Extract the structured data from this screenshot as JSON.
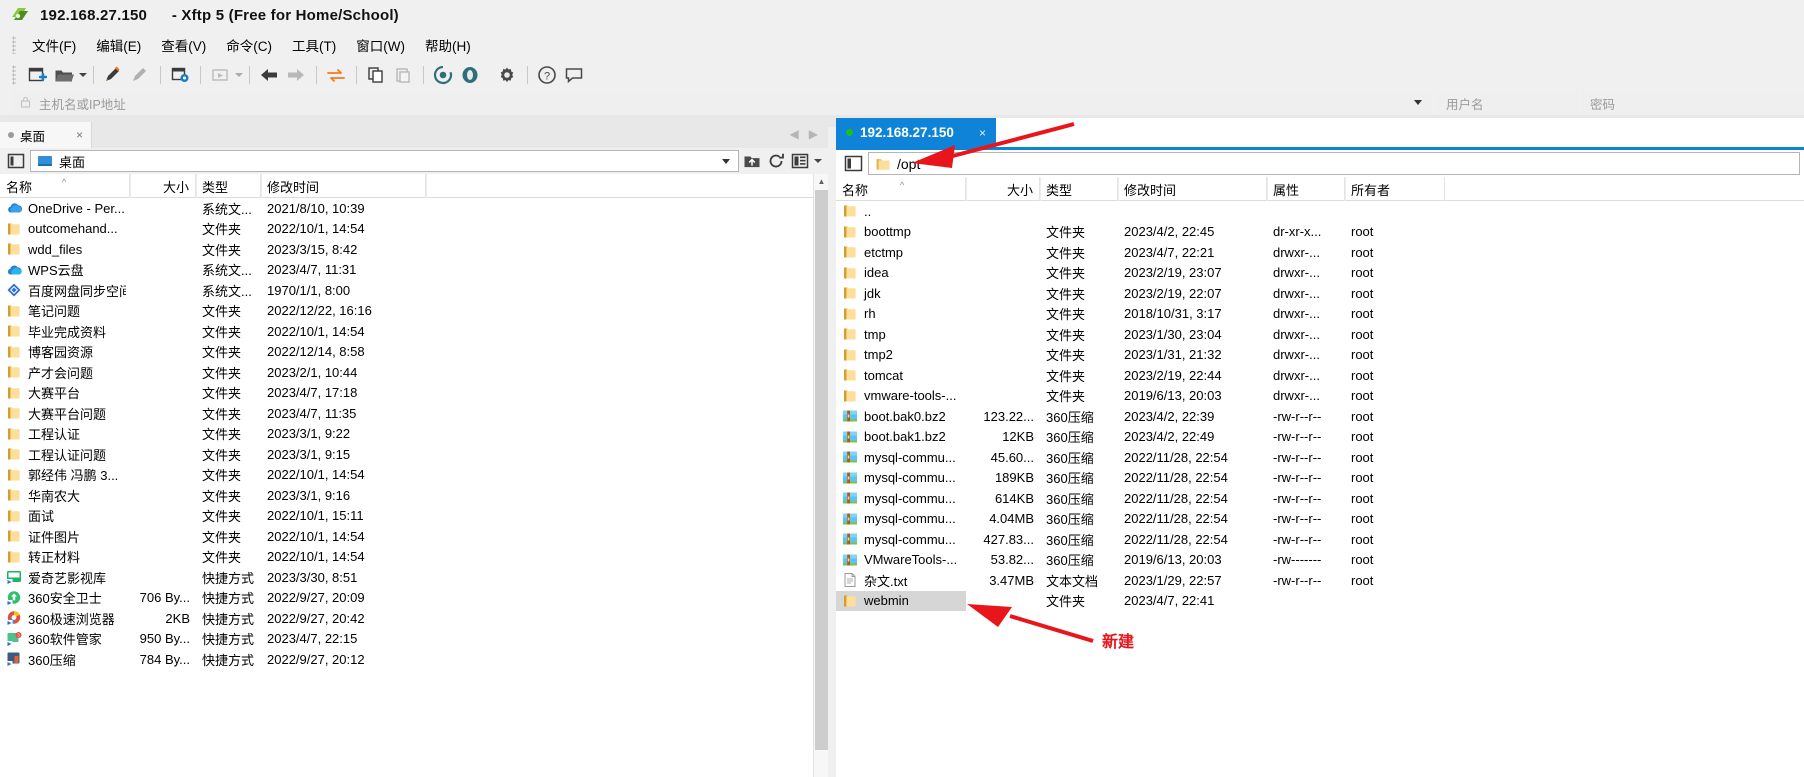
{
  "window": {
    "title_ip": "192.168.27.150",
    "title_app": "- Xftp 5 (Free for Home/School)",
    "app_icon": "xftp-logo-icon"
  },
  "menubar": {
    "items": [
      {
        "label": "文件(F)",
        "name": "menu-file"
      },
      {
        "label": "编辑(E)",
        "name": "menu-edit"
      },
      {
        "label": "查看(V)",
        "name": "menu-view"
      },
      {
        "label": "命令(C)",
        "name": "menu-command"
      },
      {
        "label": "工具(T)",
        "name": "menu-tools"
      },
      {
        "label": "窗口(W)",
        "name": "menu-window"
      },
      {
        "label": "帮助(H)",
        "name": "menu-help"
      }
    ]
  },
  "toolbar": {
    "buttons": [
      "new-session-icon",
      "open-folder-icon",
      "dropdown-caret-icon",
      "edit-session-icon",
      "disconnect-icon",
      "session-properties-icon",
      "run-icon",
      "run-caret-icon",
      "back-icon",
      "forward-icon",
      "transfer-icon",
      "copy-icon",
      "paste-icon",
      "sync-browse-icon",
      "transfer-queue-icon",
      "settings-gear-icon",
      "help-icon",
      "feedback-icon"
    ]
  },
  "connectbar": {
    "host_placeholder": "主机名或IP地址",
    "user_placeholder": "用户名",
    "password_placeholder": "密码",
    "lock_icon": "lock-icon",
    "dropdown_icon": "chevron-down-icon"
  },
  "local_panel": {
    "tab_label": "桌面",
    "tab_close_icon": "close-icon",
    "nav_back_icon": "chevron-left-icon",
    "nav_forward_icon": "chevron-right-icon",
    "panel_toggle_icon": "split-panel-icon",
    "path_value": "桌面",
    "path_icon": "desktop-icon",
    "path_dropdown_icon": "chevron-down-icon",
    "tools": [
      "up-folder-icon",
      "refresh-icon",
      "view-mode-icon",
      "view-mode-caret-icon"
    ],
    "columns": [
      "名称",
      "大小",
      "类型",
      "修改时间"
    ],
    "sort_indicator": "sort-asc-icon",
    "rows": [
      {
        "name": "OneDrive - Per...",
        "size": "",
        "type": "系统文...",
        "date": "2021/8/10, 10:39",
        "icon": "onedrive-icon"
      },
      {
        "name": "outcomehand...",
        "size": "",
        "type": "文件夹",
        "date": "2022/10/1, 14:54",
        "icon": "folder-icon"
      },
      {
        "name": "wdd_files",
        "size": "",
        "type": "文件夹",
        "date": "2023/3/15, 8:42",
        "icon": "folder-icon"
      },
      {
        "name": "WPS云盘",
        "size": "",
        "type": "系统文...",
        "date": "2023/4/7, 11:31",
        "icon": "wps-cloud-icon"
      },
      {
        "name": "百度网盘同步空间",
        "size": "",
        "type": "系统文...",
        "date": "1970/1/1, 8:00",
        "icon": "baidu-netdisk-icon"
      },
      {
        "name": "笔记问题",
        "size": "",
        "type": "文件夹",
        "date": "2022/12/22, 16:16",
        "icon": "folder-icon"
      },
      {
        "name": "毕业完成资料",
        "size": "",
        "type": "文件夹",
        "date": "2022/10/1, 14:54",
        "icon": "folder-icon"
      },
      {
        "name": "博客园资源",
        "size": "",
        "type": "文件夹",
        "date": "2022/12/14, 8:58",
        "icon": "folder-icon"
      },
      {
        "name": "产才会问题",
        "size": "",
        "type": "文件夹",
        "date": "2023/2/1, 10:44",
        "icon": "folder-icon"
      },
      {
        "name": "大赛平台",
        "size": "",
        "type": "文件夹",
        "date": "2023/4/7, 17:18",
        "icon": "folder-icon"
      },
      {
        "name": "大赛平台问题",
        "size": "",
        "type": "文件夹",
        "date": "2023/4/7, 11:35",
        "icon": "folder-icon"
      },
      {
        "name": "工程认证",
        "size": "",
        "type": "文件夹",
        "date": "2023/3/1, 9:22",
        "icon": "folder-icon"
      },
      {
        "name": "工程认证问题",
        "size": "",
        "type": "文件夹",
        "date": "2023/3/1, 9:15",
        "icon": "folder-icon"
      },
      {
        "name": "郭经伟  冯鹏  3...",
        "size": "",
        "type": "文件夹",
        "date": "2022/10/1, 14:54",
        "icon": "folder-icon"
      },
      {
        "name": "华南农大",
        "size": "",
        "type": "文件夹",
        "date": "2023/3/1, 9:16",
        "icon": "folder-icon"
      },
      {
        "name": "面试",
        "size": "",
        "type": "文件夹",
        "date": "2022/10/1, 15:11",
        "icon": "folder-icon"
      },
      {
        "name": "证件图片",
        "size": "",
        "type": "文件夹",
        "date": "2022/10/1, 14:54",
        "icon": "folder-icon"
      },
      {
        "name": "转正材料",
        "size": "",
        "type": "文件夹",
        "date": "2022/10/1, 14:54",
        "icon": "folder-icon"
      },
      {
        "name": "爱奇艺影视库",
        "size": "",
        "type": "快捷方式",
        "date": "2023/3/30, 8:51",
        "icon": "iqiyi-icon"
      },
      {
        "name": "360安全卫士",
        "size": "706 By...",
        "type": "快捷方式",
        "date": "2022/9/27, 20:09",
        "icon": "360-safe-icon"
      },
      {
        "name": "360极速浏览器",
        "size": "2KB",
        "type": "快捷方式",
        "date": "2022/9/27, 20:42",
        "icon": "360-browser-icon"
      },
      {
        "name": "360软件管家",
        "size": "950 By...",
        "type": "快捷方式",
        "date": "2023/4/7, 22:15",
        "icon": "360-soft-icon"
      },
      {
        "name": "360压缩",
        "size": "784 By...",
        "type": "快捷方式",
        "date": "2022/9/27, 20:12",
        "icon": "360-zip-icon"
      }
    ]
  },
  "remote_panel": {
    "tab_label": "192.168.27.150",
    "tab_status_icon": "connected-dot-icon",
    "tab_close_icon": "close-icon",
    "panel_toggle_icon": "split-panel-icon",
    "path_value": "/opt",
    "path_icon": "folder-icon",
    "columns": [
      "名称",
      "大小",
      "类型",
      "修改时间",
      "属性",
      "所有者"
    ],
    "sort_indicator": "sort-asc-icon",
    "rows": [
      {
        "name": "..",
        "size": "",
        "type": "",
        "date": "",
        "attr": "",
        "owner": "",
        "icon": "folder-icon"
      },
      {
        "name": "boottmp",
        "size": "",
        "type": "文件夹",
        "date": "2023/4/2, 22:45",
        "attr": "dr-xr-x...",
        "owner": "root",
        "icon": "folder-icon"
      },
      {
        "name": "etctmp",
        "size": "",
        "type": "文件夹",
        "date": "2023/4/7, 22:21",
        "attr": "drwxr-...",
        "owner": "root",
        "icon": "folder-icon"
      },
      {
        "name": "idea",
        "size": "",
        "type": "文件夹",
        "date": "2023/2/19, 23:07",
        "attr": "drwxr-...",
        "owner": "root",
        "icon": "folder-icon"
      },
      {
        "name": "jdk",
        "size": "",
        "type": "文件夹",
        "date": "2023/2/19, 22:07",
        "attr": "drwxr-...",
        "owner": "root",
        "icon": "folder-icon"
      },
      {
        "name": "rh",
        "size": "",
        "type": "文件夹",
        "date": "2018/10/31, 3:17",
        "attr": "drwxr-...",
        "owner": "root",
        "icon": "folder-icon"
      },
      {
        "name": "tmp",
        "size": "",
        "type": "文件夹",
        "date": "2023/1/30, 23:04",
        "attr": "drwxr-...",
        "owner": "root",
        "icon": "folder-icon"
      },
      {
        "name": "tmp2",
        "size": "",
        "type": "文件夹",
        "date": "2023/1/31, 21:32",
        "attr": "drwxr-...",
        "owner": "root",
        "icon": "folder-icon"
      },
      {
        "name": "tomcat",
        "size": "",
        "type": "文件夹",
        "date": "2023/2/19, 22:44",
        "attr": "drwxr-...",
        "owner": "root",
        "icon": "folder-icon"
      },
      {
        "name": "vmware-tools-...",
        "size": "",
        "type": "文件夹",
        "date": "2019/6/13, 20:03",
        "attr": "drwxr-...",
        "owner": "root",
        "icon": "folder-icon"
      },
      {
        "name": "boot.bak0.bz2",
        "size": "123.22...",
        "type": "360压缩",
        "date": "2023/4/2, 22:39",
        "attr": "-rw-r--r--",
        "owner": "root",
        "icon": "archive-icon"
      },
      {
        "name": "boot.bak1.bz2",
        "size": "12KB",
        "type": "360压缩",
        "date": "2023/4/2, 22:49",
        "attr": "-rw-r--r--",
        "owner": "root",
        "icon": "archive-icon"
      },
      {
        "name": "mysql-commu...",
        "size": "45.60...",
        "type": "360压缩",
        "date": "2022/11/28, 22:54",
        "attr": "-rw-r--r--",
        "owner": "root",
        "icon": "archive-icon"
      },
      {
        "name": "mysql-commu...",
        "size": "189KB",
        "type": "360压缩",
        "date": "2022/11/28, 22:54",
        "attr": "-rw-r--r--",
        "owner": "root",
        "icon": "archive-icon"
      },
      {
        "name": "mysql-commu...",
        "size": "614KB",
        "type": "360压缩",
        "date": "2022/11/28, 22:54",
        "attr": "-rw-r--r--",
        "owner": "root",
        "icon": "archive-icon"
      },
      {
        "name": "mysql-commu...",
        "size": "4.04MB",
        "type": "360压缩",
        "date": "2022/11/28, 22:54",
        "attr": "-rw-r--r--",
        "owner": "root",
        "icon": "archive-icon"
      },
      {
        "name": "mysql-commu...",
        "size": "427.83...",
        "type": "360压缩",
        "date": "2022/11/28, 22:54",
        "attr": "-rw-r--r--",
        "owner": "root",
        "icon": "archive-icon"
      },
      {
        "name": "VMwareTools-...",
        "size": "53.82...",
        "type": "360压缩",
        "date": "2019/6/13, 20:03",
        "attr": "-rw-------",
        "owner": "root",
        "icon": "archive-icon"
      },
      {
        "name": "杂文.txt",
        "size": "3.47MB",
        "type": "文本文档",
        "date": "2023/1/29, 22:57",
        "attr": "-rw-r--r--",
        "owner": "root",
        "icon": "text-file-icon"
      },
      {
        "name": "webmin",
        "size": "",
        "type": "文件夹",
        "date": "2023/4/7, 22:41",
        "attr": "",
        "owner": "",
        "icon": "folder-icon",
        "selected": true
      }
    ]
  },
  "annotations": {
    "label_new": "新建",
    "arrow_color": "#e8151b",
    "arrow_to_path_name": "arrow-pointing-to-path",
    "arrow_to_webmin_name": "arrow-pointing-to-webmin"
  },
  "colors": {
    "accent_blue": "#0f83d8",
    "folder_yellow": "#f7d27c",
    "annotation_red": "#e8151b",
    "selection_gray": "#d6d6d6"
  }
}
